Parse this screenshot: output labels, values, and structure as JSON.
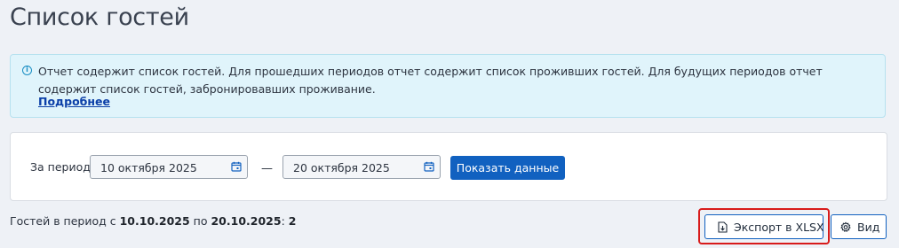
{
  "page": {
    "title": "Список гостей"
  },
  "info": {
    "text": "Отчет содержит список гостей. Для прошедших периодов отчет содержит список проживших гостей. Для будущих периодов отчет содержит список гостей, забронировавших проживание.",
    "link": "Подробнее"
  },
  "filter": {
    "period_label": "За период:",
    "date_from": "10 октября 2025",
    "date_to": "20 октября 2025",
    "separator": "—",
    "show_button": "Показать данные"
  },
  "summary": {
    "prefix": "Гостей в период с",
    "from": "10.10.2025",
    "mid": "по",
    "to": "20.10.2025",
    "colon": ":",
    "count": "2"
  },
  "actions": {
    "export_label": "Экспорт в XLSX",
    "view_label": "Вид"
  },
  "colors": {
    "accent": "#1161c0",
    "highlight": "#d81b1b",
    "info_bg": "#e0f4fb"
  }
}
